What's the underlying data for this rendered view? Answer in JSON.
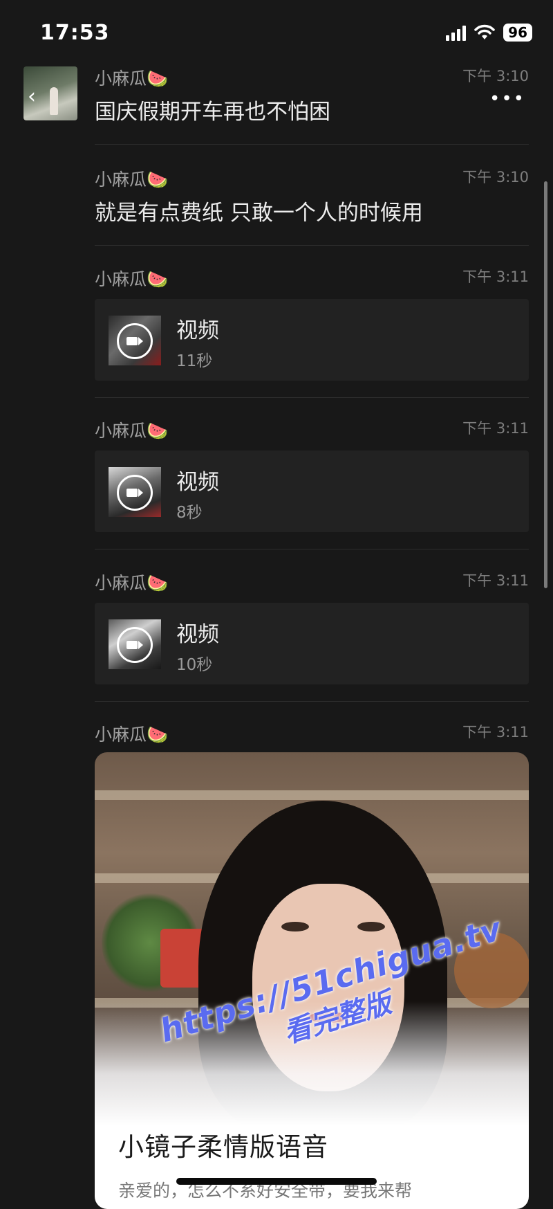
{
  "status_bar": {
    "time": "17:53",
    "battery": "96"
  },
  "messages": [
    {
      "sender": "小麻瓜🍉",
      "time": "下午 3:10",
      "text": "国庆假期开车再也不怕困"
    },
    {
      "sender": "小麻瓜🍉",
      "time": "下午 3:10",
      "text": "就是有点费纸 只敢一个人的时候用"
    },
    {
      "sender": "小麻瓜🍉",
      "time": "下午 3:11",
      "video_title": "视频",
      "duration": "11秒"
    },
    {
      "sender": "小麻瓜🍉",
      "time": "下午 3:11",
      "video_title": "视频",
      "duration": "8秒"
    },
    {
      "sender": "小麻瓜🍉",
      "time": "下午 3:11",
      "video_title": "视频",
      "duration": "10秒"
    },
    {
      "sender": "小麻瓜🍉",
      "time": "下午 3:11"
    }
  ],
  "card": {
    "title": "小镜子柔情版语音",
    "description": "亲爱的，怎么不系好安全带，要我来帮"
  },
  "watermark": {
    "url": "https://51chigua.tv",
    "subtitle": "看完整版"
  },
  "icons": {
    "more": "more-icon",
    "video": "video-camera-icon",
    "back": "back-arrow-icon"
  }
}
